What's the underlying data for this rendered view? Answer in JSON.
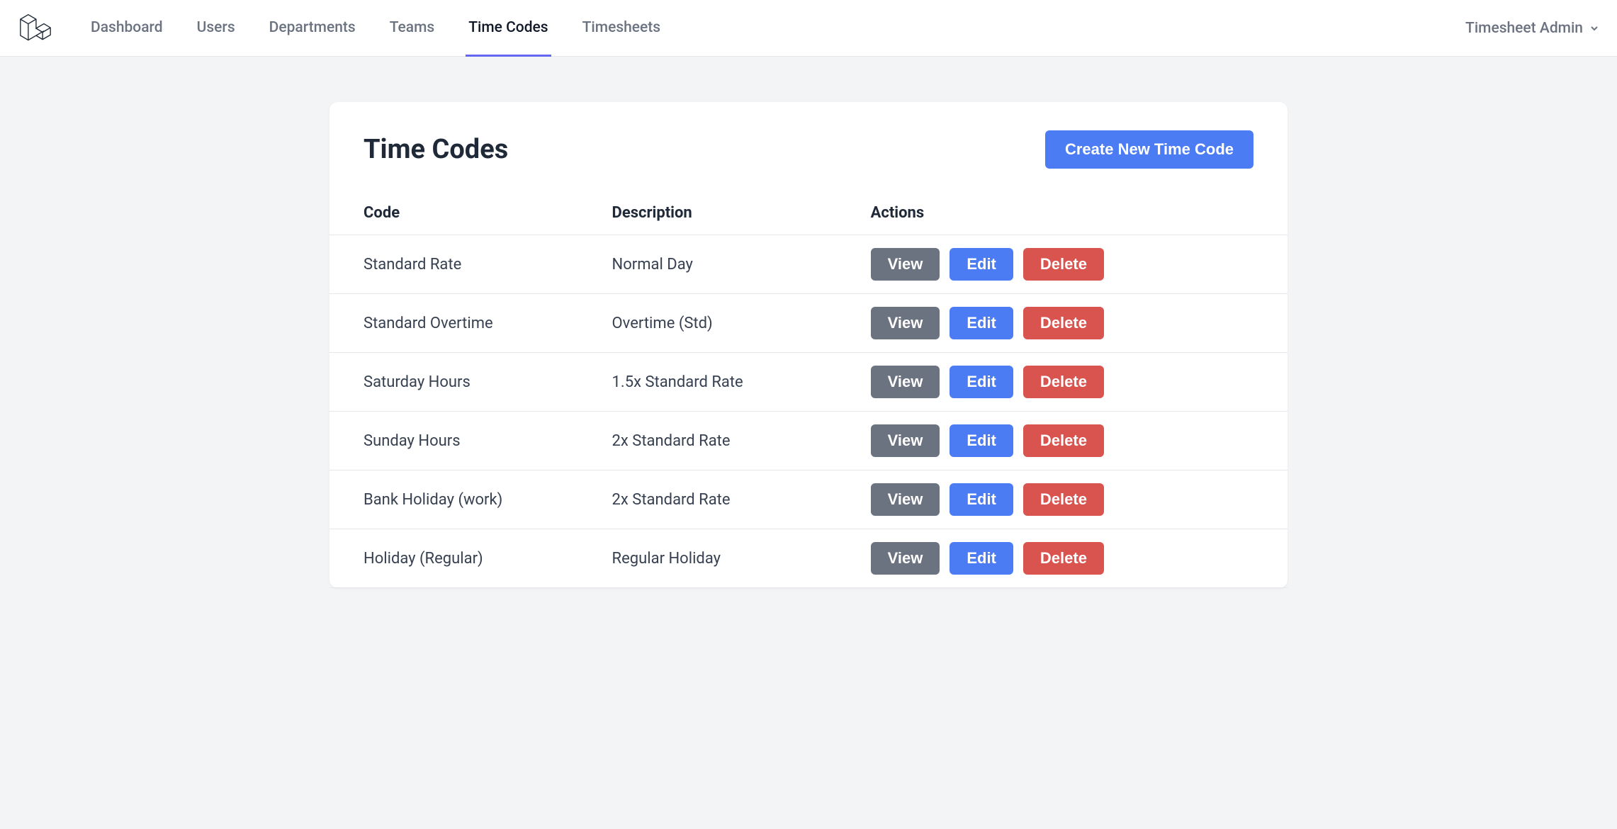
{
  "nav": {
    "items": [
      {
        "label": "Dashboard",
        "active": false
      },
      {
        "label": "Users",
        "active": false
      },
      {
        "label": "Departments",
        "active": false
      },
      {
        "label": "Teams",
        "active": false
      },
      {
        "label": "Time Codes",
        "active": true
      },
      {
        "label": "Timesheets",
        "active": false
      }
    ],
    "user_label": "Timesheet Admin"
  },
  "page": {
    "title": "Time Codes",
    "create_button": "Create New Time Code"
  },
  "table": {
    "headers": {
      "code": "Code",
      "description": "Description",
      "actions": "Actions"
    },
    "actions": {
      "view": "View",
      "edit": "Edit",
      "delete": "Delete"
    },
    "rows": [
      {
        "code": "Standard Rate",
        "description": "Normal Day"
      },
      {
        "code": "Standard Overtime",
        "description": "Overtime (Std)"
      },
      {
        "code": "Saturday Hours",
        "description": "1.5x Standard Rate"
      },
      {
        "code": "Sunday Hours",
        "description": "2x Standard Rate"
      },
      {
        "code": "Bank Holiday (work)",
        "description": "2x Standard Rate"
      },
      {
        "code": "Holiday (Regular)",
        "description": "Regular Holiday"
      }
    ]
  }
}
